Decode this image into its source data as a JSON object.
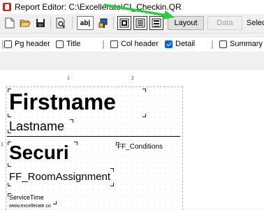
{
  "window": {
    "title": "Report Editor: C:\\Excellerate\\CI_Checkin.QR",
    "accent_color": "#c62828"
  },
  "toolbar": {
    "icons": [
      "new-document-icon",
      "open-folder-icon",
      "save-disk-icon",
      "print-preview-icon",
      "text-field-icon",
      "paint-icon",
      "layout-view-icon",
      "data-view-icon",
      "list-view-icon"
    ],
    "text_field_label": "ab|",
    "layout_label": "Layout",
    "data_label": "Data",
    "select_label": "Selec"
  },
  "sections": {
    "pg_header": {
      "label": "Pg header",
      "checked": false
    },
    "title": {
      "label": "Title",
      "checked": false
    },
    "col_header": {
      "label": "Col header",
      "checked": false
    },
    "detail": {
      "label": "Detail",
      "checked": true
    },
    "summary": {
      "label": "Summary",
      "checked": false
    }
  },
  "ruler": {
    "marks": [
      "1",
      "2"
    ],
    "vertical_mark": "1"
  },
  "report": {
    "fields": {
      "firstname": "Firstname",
      "lastname": "Lastname",
      "securi": "Securi",
      "conditions": "FF_Conditions",
      "room_assignment": "FF_RoomAssignment",
      "service_time": "ServiceTime",
      "website": "www.excellerate.co"
    }
  },
  "annotation": {
    "arrow_color": "#2ecc40"
  }
}
